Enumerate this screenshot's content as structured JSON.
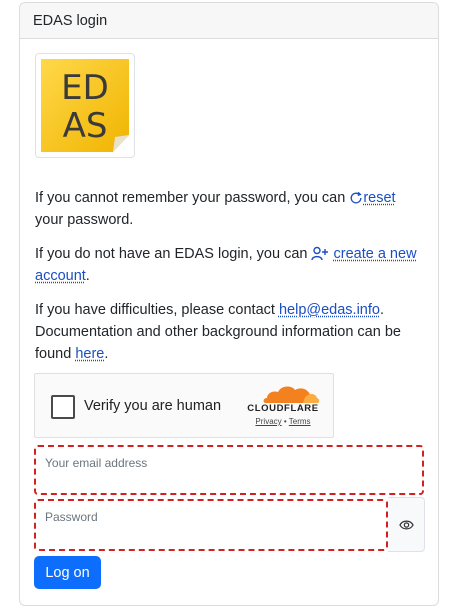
{
  "header": {
    "title": "EDAS login"
  },
  "logo": {
    "line1": "ED",
    "line2": "AS"
  },
  "reset_para": {
    "text_before": "If you cannot remember your password, you can ",
    "link": "reset",
    "text_after": " your password.",
    "icon": "refresh-icon"
  },
  "create_para": {
    "text_before": "If you do not have an EDAS login, you can ",
    "link": "create a new account",
    "text_after": ".",
    "icon": "person-plus-icon"
  },
  "help_para": {
    "text_before": "If you have difficulties, please contact ",
    "email": "help@edas.info",
    "text_middle": ". Documentation and other background information can be found ",
    "here_link": "here",
    "text_after": "."
  },
  "captcha": {
    "label": "Verify you are human",
    "brand": "CLOUDFLARE",
    "privacy": "Privacy",
    "separator": "•",
    "terms": "Terms"
  },
  "form": {
    "email_placeholder": "Your email address",
    "password_placeholder": "Password",
    "eye_icon": "eye-icon",
    "submit_label": "Log on"
  },
  "colors": {
    "primary": "#0d6efd",
    "link": "#1a4ec2",
    "highlight_dashed": "#d32020",
    "logo_yellow": "#f5c518",
    "cloudflare_orange": "#f48120"
  }
}
